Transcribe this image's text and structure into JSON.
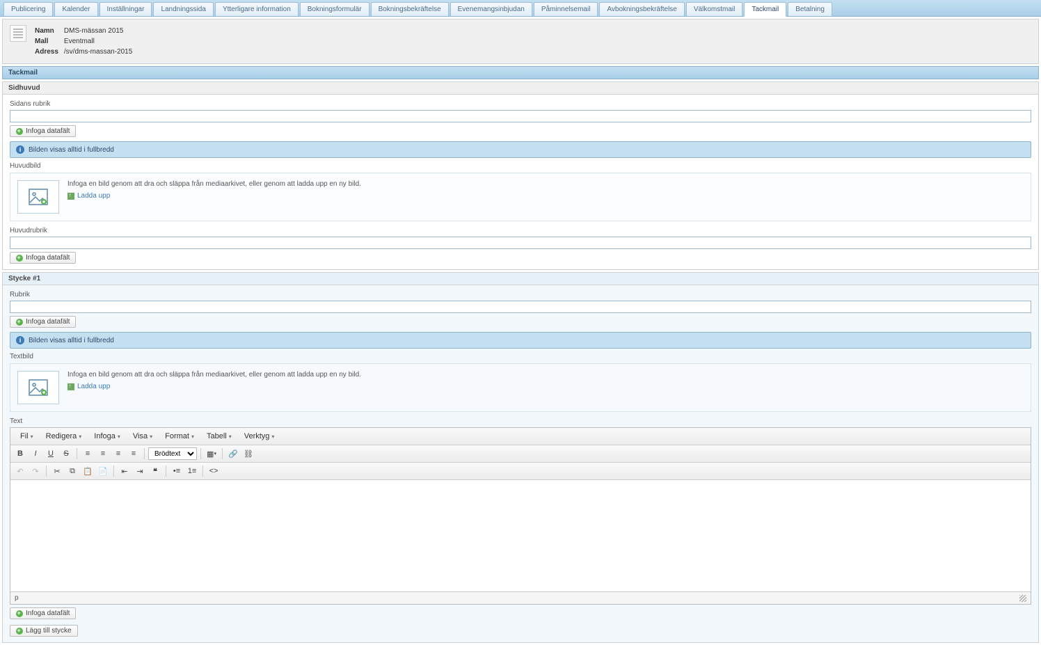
{
  "tabs": [
    "Publicering",
    "Kalender",
    "Inställningar",
    "Landningssida",
    "Ytterligare information",
    "Bokningsformulär",
    "Bokningsbekräftelse",
    "Evenemangsinbjudan",
    "Påminnelsemail",
    "Avbokningsbekräftelse",
    "Välkomstmail",
    "Tackmail",
    "Betalning"
  ],
  "active_tab_index": 11,
  "header": {
    "name_label": "Namn",
    "name_value": "DMS-mässan 2015",
    "mall_label": "Mall",
    "mall_value": "Eventmall",
    "adress_label": "Adress",
    "adress_value": "/sv/dms-massan-2015"
  },
  "section_title": "Tackmail",
  "panels": {
    "sidhuvud": {
      "title": "Sidhuvud",
      "rubrik_label": "Sidans rubrik",
      "infoga_datafalt": "Infoga datafält",
      "info_banner": "Bilden visas alltid i fullbredd",
      "huvudbild_label": "Huvudbild",
      "upload_text": "Infoga en bild genom att dra och släppa från mediaarkivet, eller genom att ladda upp en ny bild.",
      "upload_btn": "Ladda upp",
      "huvudrubrik_label": "Huvudrubrik"
    },
    "stycke1": {
      "title": "Stycke #1",
      "rubrik_label": "Rubrik",
      "infoga_datafalt": "Infoga datafält",
      "info_banner": "Bilden visas alltid i fullbredd",
      "textbild_label": "Textbild",
      "upload_text": "Infoga en bild genom att dra och släppa från mediaarkivet, eller genom att ladda upp en ny bild.",
      "upload_btn": "Ladda upp",
      "text_label": "Text",
      "lagg_till_stycke": "Lägg till stycke"
    }
  },
  "editor": {
    "menus": [
      "Fil",
      "Redigera",
      "Infoga",
      "Visa",
      "Format",
      "Tabell",
      "Verktyg"
    ],
    "format_select": "Brödtext",
    "status_path": "p"
  }
}
